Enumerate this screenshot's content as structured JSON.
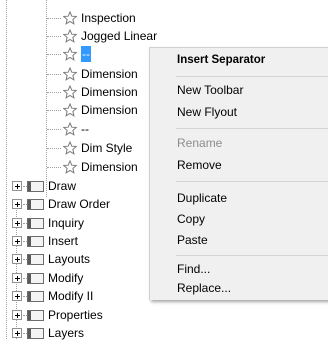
{
  "tree": {
    "commands": [
      {
        "label": "Inspection",
        "selected": false
      },
      {
        "label": "Jogged Linear",
        "selected": false
      },
      {
        "label": "--",
        "selected": true
      },
      {
        "label": "Dimension",
        "selected": false
      },
      {
        "label": "Dimension",
        "selected": false
      },
      {
        "label": "Dimension",
        "selected": false
      },
      {
        "label": "--",
        "selected": false
      },
      {
        "label": "Dim Style",
        "selected": false
      },
      {
        "label": "Dimension",
        "selected": false
      }
    ],
    "toolbars": [
      {
        "label": "Draw"
      },
      {
        "label": "Draw Order"
      },
      {
        "label": "Inquiry"
      },
      {
        "label": "Insert"
      },
      {
        "label": "Layouts"
      },
      {
        "label": "Modify"
      },
      {
        "label": "Modify II"
      },
      {
        "label": "Properties"
      },
      {
        "label": "Layers"
      }
    ]
  },
  "context_menu": {
    "items": [
      {
        "label": "Insert Separator",
        "enabled": true
      },
      {
        "label": "New Toolbar",
        "enabled": true
      },
      {
        "label": "New Flyout",
        "enabled": true
      },
      {
        "label": "Rename",
        "enabled": false
      },
      {
        "label": "Remove",
        "enabled": true
      },
      {
        "label": "Duplicate",
        "enabled": true
      },
      {
        "label": "Copy",
        "enabled": true
      },
      {
        "label": "Paste",
        "enabled": true
      },
      {
        "label": "Find...",
        "enabled": true
      },
      {
        "label": "Replace...",
        "enabled": true
      }
    ]
  }
}
